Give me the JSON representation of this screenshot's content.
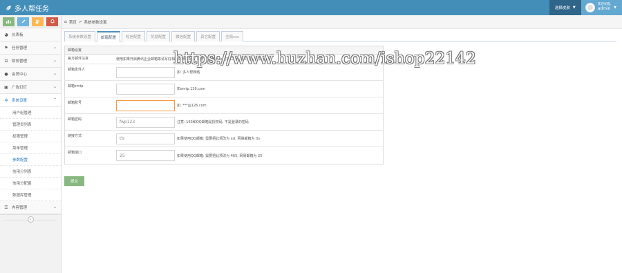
{
  "app": {
    "title": "多人帮任务"
  },
  "header": {
    "skin_label": "选择皮肤",
    "welcome": "欢迎光临,",
    "username": "admin"
  },
  "sidebar": {
    "shortcuts": [
      {
        "icon": "chart-icon",
        "color": "#87b87f"
      },
      {
        "icon": "pencil-icon",
        "color": "#6fb3e0"
      },
      {
        "icon": "users-icon",
        "color": "#ffb752"
      },
      {
        "icon": "bell-icon",
        "color": "#d15b47"
      }
    ],
    "items": [
      {
        "label": "仪表板",
        "icon": "dashboard-icon"
      },
      {
        "label": "任务管理",
        "icon": "flag-icon"
      },
      {
        "label": "财务管理",
        "icon": "money-icon"
      },
      {
        "label": "会员中心",
        "icon": "user-icon"
      },
      {
        "label": "广告幻灯",
        "icon": "picture-icon"
      },
      {
        "label": "系统设置",
        "icon": "gear-icon"
      }
    ],
    "sub_items": [
      "用户组管理",
      "管理员列表",
      "权限管理",
      "菜单管理",
      "参数配置",
      "信用分列表",
      "信用分配置",
      "数据库管理"
    ],
    "last_item": {
      "label": "内容管理",
      "icon": "list-icon"
    }
  },
  "breadcrumb": {
    "home": "首页",
    "separator": ">",
    "current": "系统参数设置"
  },
  "tabs": [
    "系统参数设置",
    "邮箱配置",
    "短信配置",
    "奖励配置",
    "微信配置",
    "其它配置",
    "全局css"
  ],
  "active_tab": 1,
  "panel": {
    "header": "邮箱设置",
    "note_label": "官方邮件注意",
    "note_text": "使用如果开启腾讯企业邮箱等请写好相关的参数配置 需要注意:使用ssl时端口号不能少 注意写好",
    "fields": [
      {
        "label": "邮箱发件人",
        "value": "",
        "placeholder": "",
        "hint": "如: 多人帮网络"
      },
      {
        "label": "邮箱smtp",
        "value": "",
        "placeholder": "",
        "hint": "如smtp.126.com"
      },
      {
        "label": "邮箱账号",
        "value": "",
        "placeholder": "",
        "hint": "如: ***@126.com"
      },
      {
        "label": "邮箱密码",
        "value": "fwp123",
        "placeholder": "",
        "hint": "注意: 163和QQ邮箱是授权码, 不是登录的密码"
      },
      {
        "label": "链接方式",
        "value": "tls",
        "placeholder": "",
        "hint": "如果使用QQ邮箱: 需要把此项改为 ssl, 网易邮箱为 tls"
      },
      {
        "label": "邮箱端口",
        "value": "25",
        "placeholder": "",
        "hint": "如果使用QQ邮箱: 需要把此项改为 465, 网易邮箱为 25"
      }
    ],
    "submit_label": "提交"
  },
  "watermark": "https://www.huzhan.com/ishop22142",
  "colors": {
    "navbar": "#438eb9",
    "accent": "#2b7dbc",
    "submit": "#87b87f"
  }
}
